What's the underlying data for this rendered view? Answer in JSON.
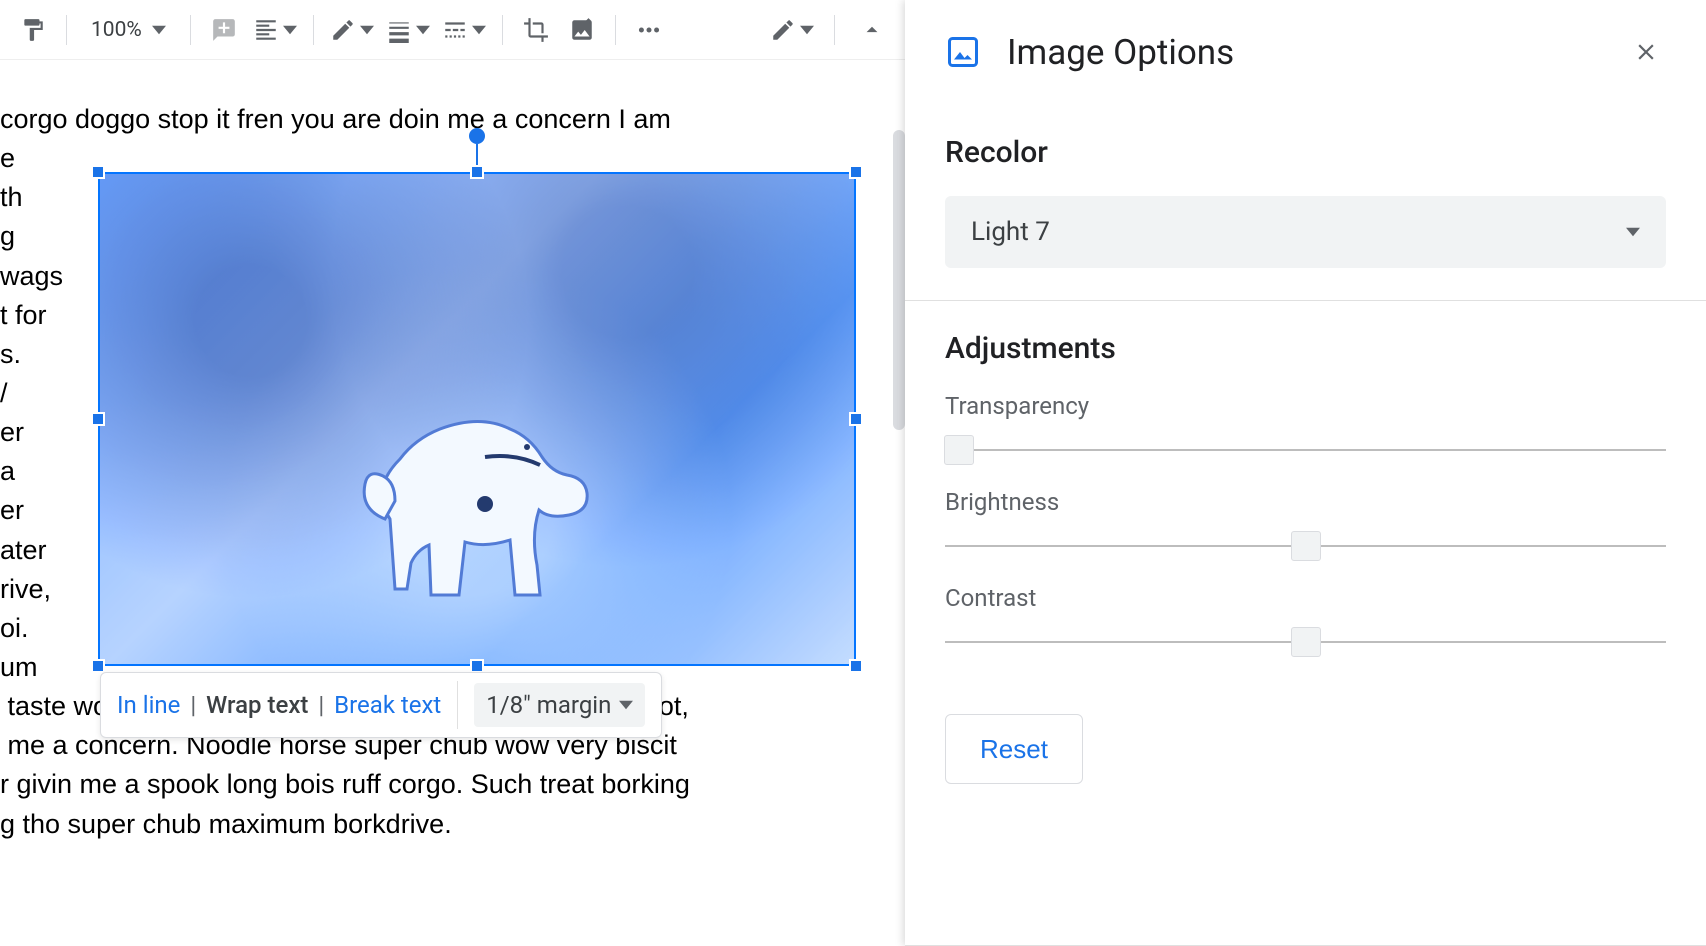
{
  "toolbar": {
    "zoom": "100%"
  },
  "doc": {
    "lines_top": [
      "corgo doggo stop it fren you are doin me a concern I am",
      "e",
      "th",
      "g",
      "wags",
      "t for",
      "s.",
      "/",
      "er",
      "a",
      "er",
      "ater",
      "rive,",
      "oi.",
      "um"
    ],
    "lines_bottom": [
      " taste wow extremely cuuuuuute yapper many pats snoot,",
      " me a concern. Noodle horse super chub wow very biscit",
      "r givin me a spook long bois ruff corgo. Such treat borking",
      "g tho super chub maximum borkdrive."
    ]
  },
  "wrap": {
    "inline": "In line",
    "wrap": "Wrap text",
    "break": "Break text",
    "margin": "1/8\" margin"
  },
  "panel": {
    "title": "Image Options",
    "recolor_title": "Recolor",
    "recolor_value": "Light 7",
    "adjustments_title": "Adjustments",
    "transparency_label": "Transparency",
    "brightness_label": "Brightness",
    "contrast_label": "Contrast",
    "reset": "Reset"
  },
  "sliders": {
    "transparency_pct": 2,
    "brightness_pct": 50,
    "contrast_pct": 50
  }
}
